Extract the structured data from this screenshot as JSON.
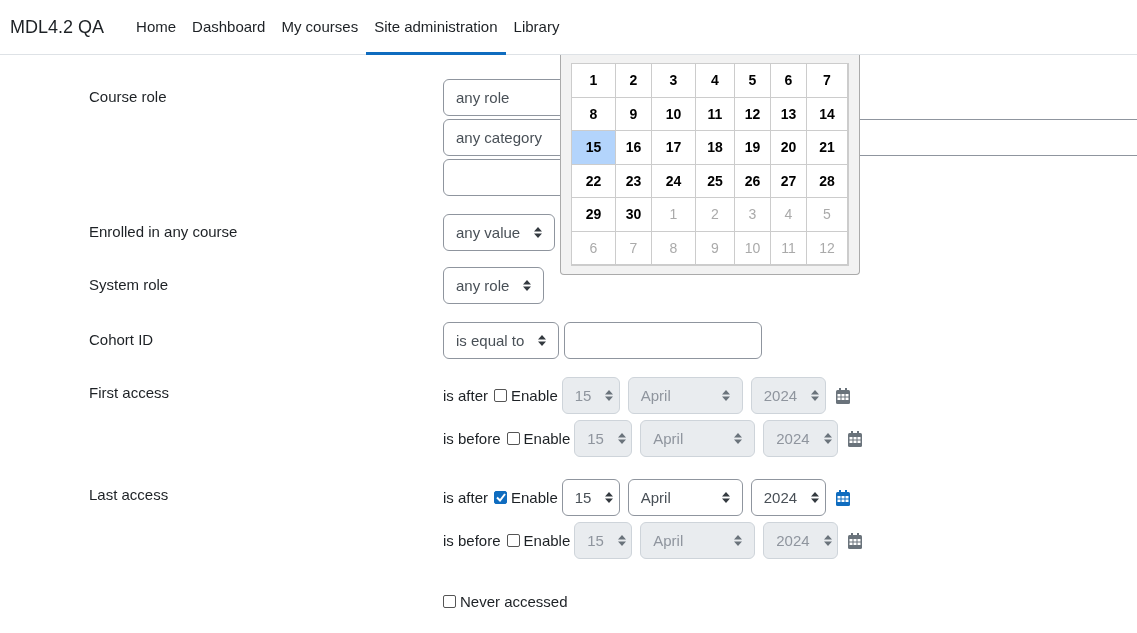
{
  "navbar": {
    "brand": "MDL4.2 QA",
    "items": [
      {
        "label": "Home",
        "selected": false
      },
      {
        "label": "Dashboard",
        "selected": false
      },
      {
        "label": "My courses",
        "selected": false
      },
      {
        "label": "Site administration",
        "selected": true
      },
      {
        "label": "Library",
        "selected": false
      }
    ]
  },
  "course_role": {
    "label": "Course role",
    "role": "any role",
    "category": "any category"
  },
  "fields": [
    {
      "kind": "select",
      "label": "Enrolled in any course",
      "value": "any value"
    },
    {
      "kind": "select",
      "label": "System role",
      "value": "any role"
    },
    {
      "kind": "select_text",
      "label": "Cohort ID",
      "value": "is equal to"
    }
  ],
  "date_fields": [
    {
      "label": "First access",
      "rows": [
        {
          "label": "is after",
          "checked": false,
          "enable": "Enable",
          "day": "15",
          "month": "April",
          "year": "2024"
        },
        {
          "label": "is before",
          "checked": false,
          "enable": "Enable",
          "day": "15",
          "month": "April",
          "year": "2024"
        }
      ]
    },
    {
      "label": "Last access",
      "rows": [
        {
          "label": "is after",
          "checked": true,
          "enable": "Enable",
          "day": "15",
          "month": "April",
          "year": "2024"
        },
        {
          "label": "is before",
          "checked": false,
          "enable": "Enable",
          "day": "15",
          "month": "April",
          "year": "2024"
        }
      ]
    }
  ],
  "never_accessed": {
    "label": "Never accessed",
    "checked": false
  },
  "calendar": {
    "weeks": [
      [
        {
          "day": "1",
          "selected": false,
          "outside": false
        },
        {
          "day": "2",
          "selected": false,
          "outside": false
        },
        {
          "day": "3",
          "selected": false,
          "outside": false
        },
        {
          "day": "4",
          "selected": false,
          "outside": false
        },
        {
          "day": "5",
          "selected": false,
          "outside": false
        },
        {
          "day": "6",
          "selected": false,
          "outside": false
        },
        {
          "day": "7",
          "selected": false,
          "outside": false
        }
      ],
      [
        {
          "day": "8",
          "selected": false,
          "outside": false
        },
        {
          "day": "9",
          "selected": false,
          "outside": false
        },
        {
          "day": "10",
          "selected": false,
          "outside": false
        },
        {
          "day": "11",
          "selected": false,
          "outside": false
        },
        {
          "day": "12",
          "selected": false,
          "outside": false
        },
        {
          "day": "13",
          "selected": false,
          "outside": false
        },
        {
          "day": "14",
          "selected": false,
          "outside": false
        }
      ],
      [
        {
          "day": "15",
          "selected": true,
          "outside": false
        },
        {
          "day": "16",
          "selected": false,
          "outside": false
        },
        {
          "day": "17",
          "selected": false,
          "outside": false
        },
        {
          "day": "18",
          "selected": false,
          "outside": false
        },
        {
          "day": "19",
          "selected": false,
          "outside": false
        },
        {
          "day": "20",
          "selected": false,
          "outside": false
        },
        {
          "day": "21",
          "selected": false,
          "outside": false
        }
      ],
      [
        {
          "day": "22",
          "selected": false,
          "outside": false
        },
        {
          "day": "23",
          "selected": false,
          "outside": false
        },
        {
          "day": "24",
          "selected": false,
          "outside": false
        },
        {
          "day": "25",
          "selected": false,
          "outside": false
        },
        {
          "day": "26",
          "selected": false,
          "outside": false
        },
        {
          "day": "27",
          "selected": false,
          "outside": false
        },
        {
          "day": "28",
          "selected": false,
          "outside": false
        }
      ],
      [
        {
          "day": "29",
          "selected": false,
          "outside": false
        },
        {
          "day": "30",
          "selected": false,
          "outside": false
        },
        {
          "day": "1",
          "selected": false,
          "outside": true
        },
        {
          "day": "2",
          "selected": false,
          "outside": true
        },
        {
          "day": "3",
          "selected": false,
          "outside": true
        },
        {
          "day": "4",
          "selected": false,
          "outside": true
        },
        {
          "day": "5",
          "selected": false,
          "outside": true
        }
      ],
      [
        {
          "day": "6",
          "selected": false,
          "outside": true
        },
        {
          "day": "7",
          "selected": false,
          "outside": true
        },
        {
          "day": "8",
          "selected": false,
          "outside": true
        },
        {
          "day": "9",
          "selected": false,
          "outside": true
        },
        {
          "day": "10",
          "selected": false,
          "outside": true
        },
        {
          "day": "11",
          "selected": false,
          "outside": true
        },
        {
          "day": "12",
          "selected": false,
          "outside": true
        }
      ]
    ]
  }
}
